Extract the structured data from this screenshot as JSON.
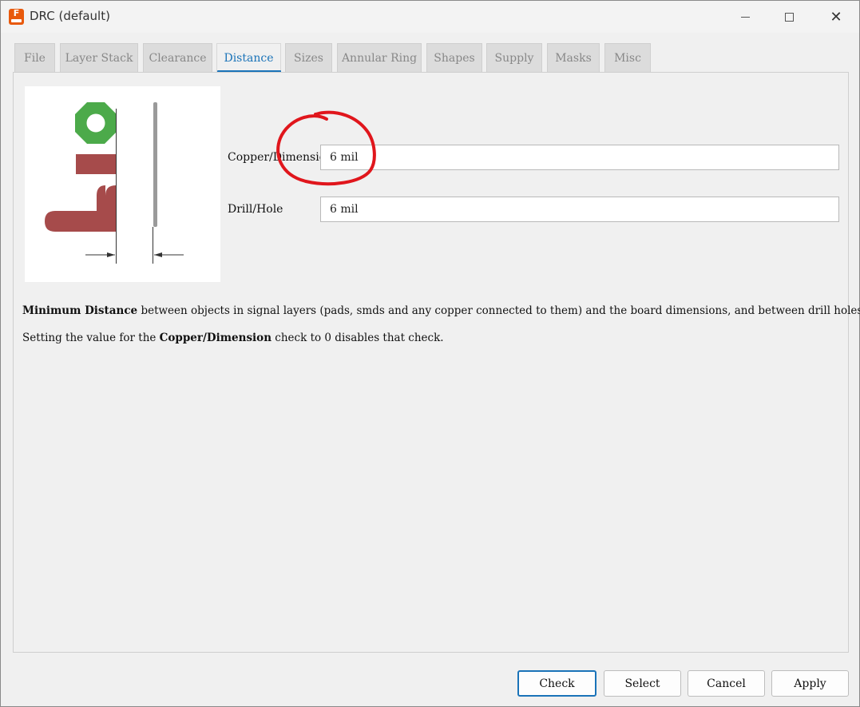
{
  "window": {
    "title": "DRC (default)",
    "app_icon_letter": "F",
    "minimize_glyph": "",
    "close_glyph": "✕"
  },
  "tabs": [
    {
      "label": "File",
      "active": false
    },
    {
      "label": "Layer Stack",
      "active": false
    },
    {
      "label": "Clearance",
      "active": false
    },
    {
      "label": "Distance",
      "active": true
    },
    {
      "label": "Sizes",
      "active": false
    },
    {
      "label": "Annular Ring",
      "active": false
    },
    {
      "label": "Shapes",
      "active": false
    },
    {
      "label": "Supply",
      "active": false
    },
    {
      "label": "Masks",
      "active": false
    },
    {
      "label": "Misc",
      "active": false
    }
  ],
  "fields": {
    "copper_dimension": {
      "label": "Copper/Dimension",
      "value": "6 mil"
    },
    "drill_hole": {
      "label": "Drill/Hole",
      "value": "6 mil"
    }
  },
  "description": {
    "line1_bold": "Minimum Distance",
    "line1_rest": " between objects in signal layers (pads, smds and any copper connected to them) and the board dimensions, and between drill holes.",
    "line2_start": "Setting the value for the ",
    "line2_bold": "Copper/Dimension",
    "line2_end": " check to 0 disables that check."
  },
  "buttons": {
    "check": "Check",
    "select": "Select",
    "cancel": "Cancel",
    "apply": "Apply"
  },
  "colors": {
    "accent": "#1a73b8",
    "pad_green": "#4caa4a",
    "copper_red": "#a64b4b",
    "annotation_red": "#e0161c"
  }
}
